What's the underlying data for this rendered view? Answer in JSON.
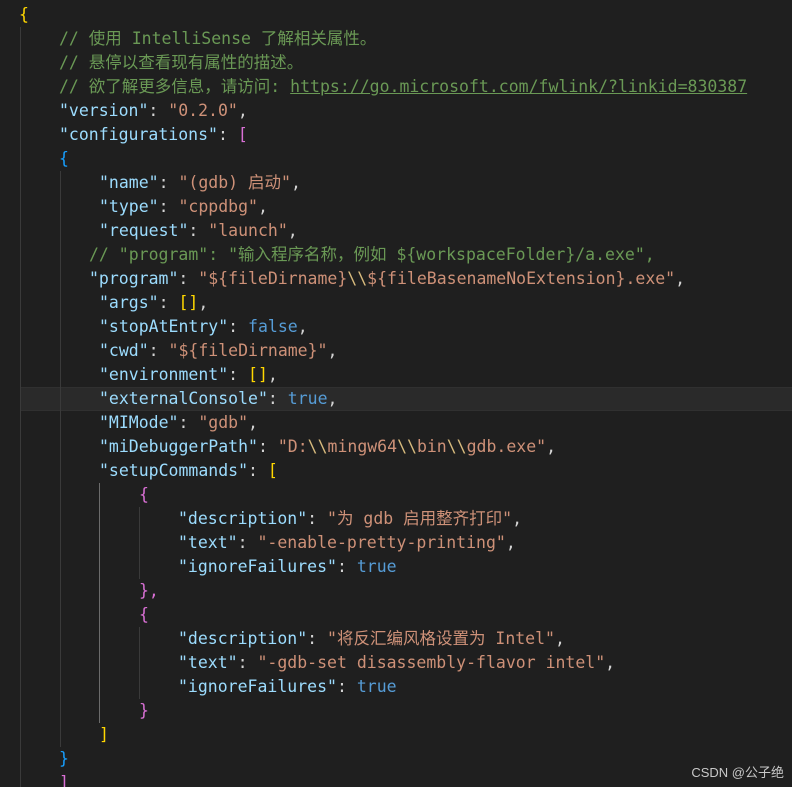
{
  "code": {
    "open_brace": "{",
    "comment_1": "// 使用 IntelliSense 了解相关属性。",
    "comment_2": "// 悬停以查看现有属性的描述。",
    "comment_3_prefix": "// 欲了解更多信息，请访问: ",
    "comment_3_link": "https://go.microsoft.com/fwlink/?linkid=830387",
    "version_key": "\"version\"",
    "version_value": "\"0.2.0\"",
    "configurations_key": "\"configurations\"",
    "config_open_bracket": "[",
    "config_item_open": "{",
    "name_key": "\"name\"",
    "name_value": "\"(gdb) 启动\"",
    "type_key": "\"type\"",
    "type_value": "\"cppdbg\"",
    "request_key": "\"request\"",
    "request_value": "\"launch\"",
    "program_comment": "// \"program\": \"输入程序名称，例如 ${workspaceFolder}/a.exe\",",
    "program_key": "\"program\"",
    "program_value_1": "\"${fileDirname}",
    "program_escape": "\\\\",
    "program_value_2": "${fileBasenameNoExtension}.exe\"",
    "args_key": "\"args\"",
    "args_value": "[]",
    "stopAtEntry_key": "\"stopAtEntry\"",
    "stopAtEntry_value": "false",
    "cwd_key": "\"cwd\"",
    "cwd_value": "\"${fileDirname}\"",
    "environment_key": "\"environment\"",
    "environment_value": "[]",
    "externalConsole_key": "\"externalConsole\"",
    "externalConsole_value": "true",
    "MIMode_key": "\"MIMode\"",
    "MIMode_value": "\"gdb\"",
    "miDebuggerPath_key": "\"miDebuggerPath\"",
    "miDebuggerPath_v1": "\"D:",
    "miDebuggerPath_esc": "\\\\",
    "miDebuggerPath_v2": "mingw64",
    "miDebuggerPath_v3": "bin",
    "miDebuggerPath_v4": "gdb.exe\"",
    "setupCommands_key": "\"setupCommands\"",
    "setup_open_bracket": "[",
    "cmd_open": "{",
    "description_key": "\"description\"",
    "desc1_value": "\"为 gdb 启用整齐打印\"",
    "text_key": "\"text\"",
    "text1_value": "\"-enable-pretty-printing\"",
    "ignoreFailures_key": "\"ignoreFailures\"",
    "ignoreFailures_value": "true",
    "cmd_close_comma": "},",
    "desc2_value": "\"将反汇编风格设置为 Intel\"",
    "text2_value": "\"-gdb-set disassembly-flavor intel\"",
    "cmd_close": "}",
    "setup_close_bracket": "]",
    "config_item_close": "}",
    "config_close_bracket": "]"
  },
  "watermark": "CSDN @公子绝"
}
